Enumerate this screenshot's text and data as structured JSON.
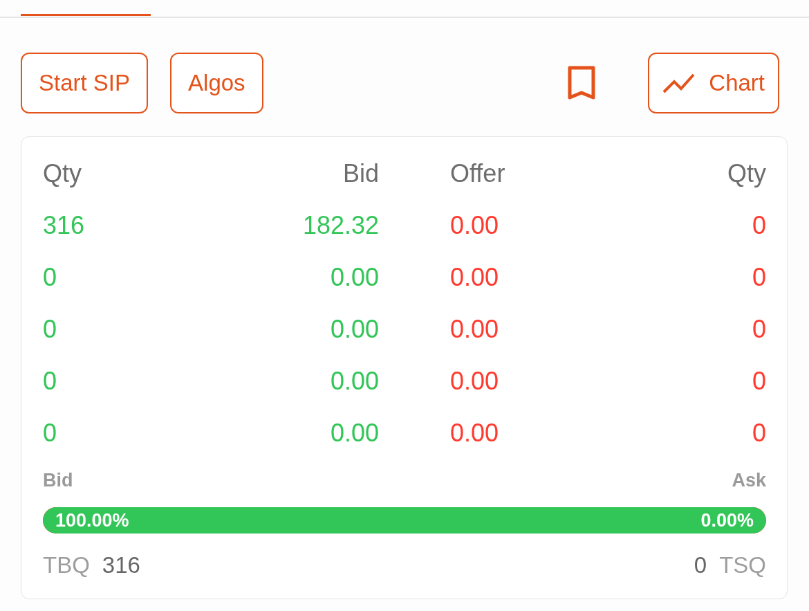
{
  "actions": [
    {
      "kind": "button",
      "label": "Start SIP"
    },
    {
      "kind": "button",
      "label": "Algos"
    },
    {
      "kind": "bookmark"
    },
    {
      "kind": "chart",
      "label": "Chart"
    }
  ],
  "market_depth": {
    "columns": [
      "Qty",
      "Bid",
      "Offer",
      "Qty"
    ],
    "rows": [
      {
        "bid_qty": "316",
        "bid": "182.32",
        "offer": "0.00",
        "offer_qty": "0"
      },
      {
        "bid_qty": "0",
        "bid": "0.00",
        "offer": "0.00",
        "offer_qty": "0"
      },
      {
        "bid_qty": "0",
        "bid": "0.00",
        "offer": "0.00",
        "offer_qty": "0"
      },
      {
        "bid_qty": "0",
        "bid": "0.00",
        "offer": "0.00",
        "offer_qty": "0"
      },
      {
        "bid_qty": "0",
        "bid": "0.00",
        "offer": "0.00",
        "offer_qty": "0"
      }
    ],
    "bid_label": "Bid",
    "ask_label": "Ask",
    "split": {
      "level": 1,
      "bid_percent": "100.00%",
      "ask_percent": "0.00%"
    },
    "totals": {
      "tbq_label": "TBQ",
      "tbq": "316",
      "tsq": "0",
      "tsq_label": "TSQ"
    }
  }
}
